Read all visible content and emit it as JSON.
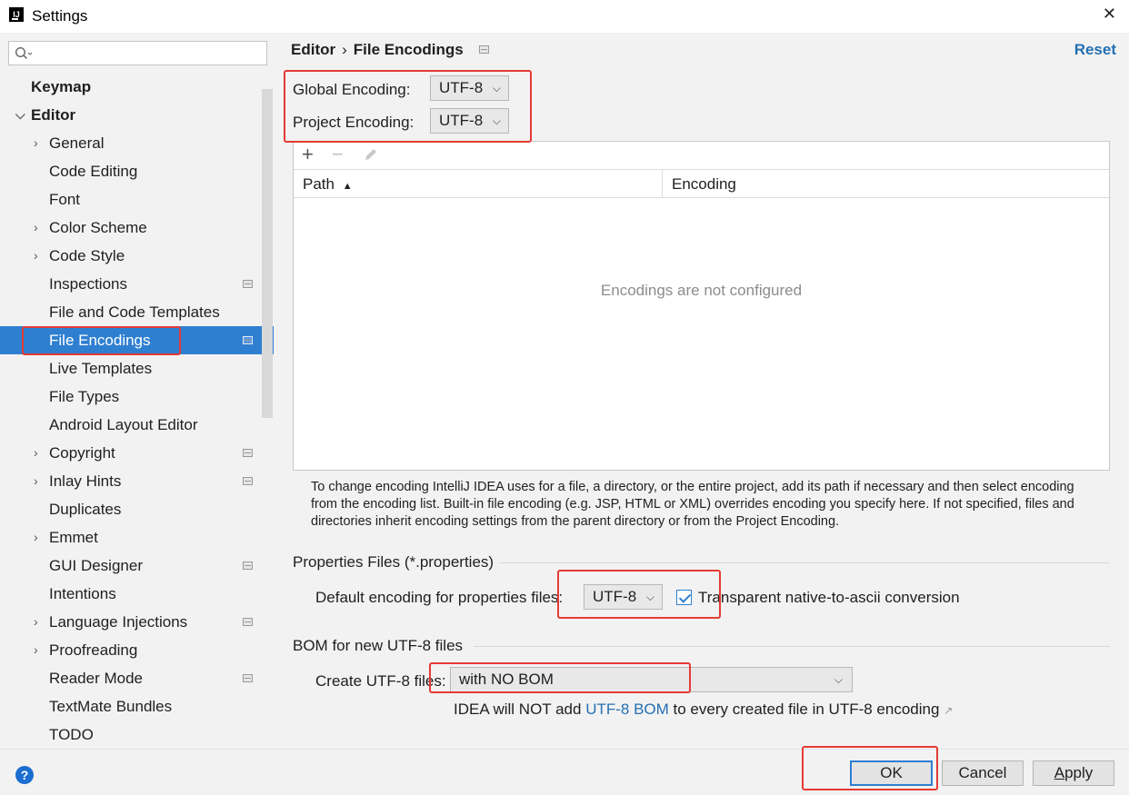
{
  "window": {
    "title": "Settings",
    "app_icon_text": "IJ"
  },
  "search": {
    "placeholder": "",
    "value": ""
  },
  "sidebar": {
    "items": [
      {
        "label": "Keymap",
        "bold": true,
        "expandable": false,
        "project_icon": false
      },
      {
        "label": "Editor",
        "bold": true,
        "expanded": true,
        "project_icon": false
      },
      {
        "label": "General",
        "expandable": true,
        "project_icon": false
      },
      {
        "label": "Code Editing",
        "expandable": false,
        "project_icon": false
      },
      {
        "label": "Font",
        "expandable": false,
        "project_icon": false
      },
      {
        "label": "Color Scheme",
        "expandable": true,
        "project_icon": false
      },
      {
        "label": "Code Style",
        "expandable": true,
        "project_icon": false
      },
      {
        "label": "Inspections",
        "expandable": false,
        "project_icon": true
      },
      {
        "label": "File and Code Templates",
        "expandable": false,
        "project_icon": false
      },
      {
        "label": "File Encodings",
        "expandable": false,
        "project_icon": true,
        "selected": true
      },
      {
        "label": "Live Templates",
        "expandable": false,
        "project_icon": false
      },
      {
        "label": "File Types",
        "expandable": false,
        "project_icon": false
      },
      {
        "label": "Android Layout Editor",
        "expandable": false,
        "project_icon": false
      },
      {
        "label": "Copyright",
        "expandable": true,
        "project_icon": true
      },
      {
        "label": "Inlay Hints",
        "expandable": true,
        "project_icon": true
      },
      {
        "label": "Duplicates",
        "expandable": false,
        "project_icon": false
      },
      {
        "label": "Emmet",
        "expandable": true,
        "project_icon": false
      },
      {
        "label": "GUI Designer",
        "expandable": false,
        "project_icon": true
      },
      {
        "label": "Intentions",
        "expandable": false,
        "project_icon": false
      },
      {
        "label": "Language Injections",
        "expandable": true,
        "project_icon": true
      },
      {
        "label": "Proofreading",
        "expandable": true,
        "project_icon": false
      },
      {
        "label": "Reader Mode",
        "expandable": false,
        "project_icon": true
      },
      {
        "label": "TextMate Bundles",
        "expandable": false,
        "project_icon": false
      },
      {
        "label": "TODO",
        "expandable": false,
        "project_icon": false
      }
    ]
  },
  "breadcrumb": {
    "parent": "Editor",
    "separator": "›",
    "current": "File Encodings"
  },
  "reset_label": "Reset",
  "encodings": {
    "global_label": "Global Encoding:",
    "global_value": "UTF-8",
    "project_label": "Project Encoding:",
    "project_value": "UTF-8"
  },
  "table": {
    "toolbar": {
      "add": "+",
      "remove": "−"
    },
    "columns": {
      "path": "Path",
      "path_sort": "▲",
      "encoding": "Encoding"
    },
    "empty_text": "Encodings are not configured"
  },
  "help_text": "To change encoding IntelliJ IDEA uses for a file, a directory, or the entire project, add its path if necessary and then select encoding from the encoding list. Built-in file encoding (e.g. JSP, HTML or XML) overrides encoding you specify here. If not specified, files and directories inherit encoding settings from the parent directory or from the Project Encoding.",
  "properties": {
    "section_title": "Properties Files (*.properties)",
    "default_label": "Default encoding for properties files:",
    "default_value": "UTF-8",
    "native_to_ascii_label": "Transparent native-to-ascii conversion",
    "native_to_ascii_checked": true
  },
  "bom": {
    "section_title": "BOM for new UTF-8 files",
    "create_label": "Create UTF-8 files:",
    "create_value": "with NO BOM",
    "note_prefix": "IDEA will NOT add ",
    "note_link": "UTF-8 BOM",
    "note_suffix": " to every created file in UTF-8 encoding",
    "note_arrow": "↗"
  },
  "buttons": {
    "help": "?",
    "ok": "OK",
    "cancel": "Cancel",
    "apply_underlined": "A",
    "apply_rest": "pply"
  },
  "colors": {
    "selection": "#2f7fd1",
    "link": "#2470b3",
    "annotation_red": "#e53a35",
    "help_button": "#1b6ecf"
  }
}
